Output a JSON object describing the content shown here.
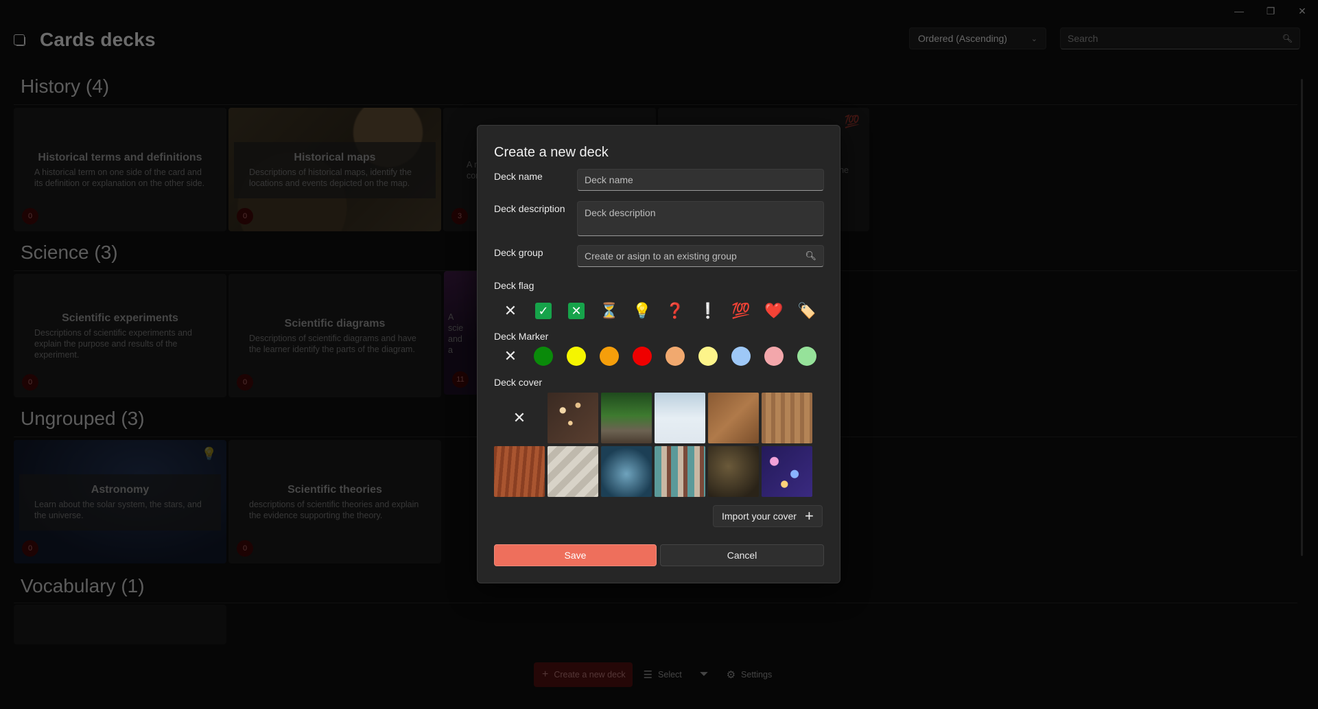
{
  "window": {
    "minimize": "—",
    "restore": "❐",
    "close": "✕"
  },
  "app": {
    "title": "Cards decks",
    "icon": "cards-icon"
  },
  "toolbar": {
    "sort": {
      "selected": "Ordered (Ascending)"
    },
    "search": {
      "placeholder": "Search"
    }
  },
  "groups": [
    {
      "title": "History (4)",
      "decks": [
        {
          "title": "Historical terms and definitions",
          "description": "A historical term on one side of the card and its definition or explanation on the other side.",
          "count": "0",
          "ribbon": "#0c8a0c"
        },
        {
          "title": "Historical maps",
          "description": "Descriptions of historical maps, identify the locations and events depicted on the map.",
          "count": "0"
        },
        {
          "title": "",
          "description": "A na cont",
          "count": "3"
        },
        {
          "title": "",
          "description": "f the",
          "count": "",
          "flag": "💯"
        }
      ]
    },
    {
      "title": "Science (3)",
      "decks": [
        {
          "title": "Scientific experiments",
          "description": "Descriptions of scientific experiments and explain the purpose and results of the experiment.",
          "count": "0"
        },
        {
          "title": "Scientific diagrams",
          "description": "Descriptions of scientific diagrams and have the learner identify the parts of the diagram.",
          "count": "0",
          "ribbon": "#a3a30a"
        },
        {
          "title": "",
          "description": "A scie and a",
          "count": "11"
        }
      ]
    },
    {
      "title": "Ungrouped (3)",
      "decks": [
        {
          "title": "Astronomy",
          "description": "Learn about the solar system, the stars, and the universe.",
          "count": "0",
          "ribbon": "#c21010",
          "flag": "💡"
        },
        {
          "title": "Scientific theories",
          "description": "descriptions of scientific theories and explain the evidence supporting the theory.",
          "count": "0"
        }
      ]
    },
    {
      "title": "Vocabulary (1)",
      "decks": []
    }
  ],
  "commandbar": {
    "create": "Create a new deck",
    "select": "Select",
    "settings": "Settings"
  },
  "dialog": {
    "title": "Create a new deck",
    "name": {
      "label": "Deck name",
      "placeholder": "Deck name"
    },
    "description": {
      "label": "Deck description",
      "placeholder": "Deck description"
    },
    "group": {
      "label": "Deck group",
      "placeholder": "Create or asign to an existing group"
    },
    "flag": {
      "label": "Deck flag",
      "options": [
        {
          "name": "none",
          "glyph": "✕"
        },
        {
          "name": "check",
          "glyph": "✓",
          "bg": "#16a34a"
        },
        {
          "name": "cross",
          "glyph": "✕",
          "bg": "#16a34a"
        },
        {
          "name": "hourglass",
          "glyph": "⏳"
        },
        {
          "name": "lightbulb",
          "glyph": "💡"
        },
        {
          "name": "question",
          "glyph": "❓"
        },
        {
          "name": "exclamation",
          "glyph": "❕"
        },
        {
          "name": "hundred",
          "glyph": "💯"
        },
        {
          "name": "heart",
          "glyph": "❤️"
        },
        {
          "name": "tag",
          "glyph": "🏷️"
        }
      ]
    },
    "marker": {
      "label": "Deck Marker",
      "colors": [
        "#0a8a0a",
        "#f5f500",
        "#f59e0b",
        "#ef0000",
        "#f1a96f",
        "#fdf48a",
        "#9ec8f7",
        "#f3a7ab",
        "#96e29a"
      ]
    },
    "cover": {
      "label": "Deck cover",
      "swatches": [
        "radial-gradient(circle at 30% 35%, #f3d7a8 0 6%, transparent 7%), radial-gradient(circle at 60% 25%, #e6c08a 0 5%, transparent 6%), radial-gradient(circle at 45% 60%, #f0cc95 0 5%, transparent 6%), linear-gradient(135deg, #3a2a22, #5a3f30)",
        "linear-gradient(180deg, #1f4a1d 0%, #3d7a2f 45%, #6c6252 75%, #4a3c30 100%)",
        "linear-gradient(180deg, #bcd0de 0%, #e6eef4 50%, #dfe7ee 100%)",
        "linear-gradient(135deg, #8a5a33, #b07a4a 50%, #7a4e2b)",
        "repeating-linear-gradient(90deg, #9a6c45 0 6px, #b48456 6px 14px)",
        "repeating-linear-gradient(95deg, #8a3f22 0 5px, #a95530 5px 11px)",
        "repeating-linear-gradient(135deg, #d8d3c8 0 10px, #bfb9ad 10px 20px)",
        "radial-gradient(circle at 50% 55%, #6fa3bd, #1c3f55 70%)",
        "repeating-linear-gradient(90deg, #5b9a9a 0 10px, #c9b7a3 10px 18px, #7a4a3a 18px 24px)",
        "radial-gradient(circle at 40% 40%, #6b5a3a, #2a2318 80%)",
        "radial-gradient(circle at 25% 30%, #f2a2d8 0 8%, transparent 9%), radial-gradient(circle at 65% 55%, #8ab4ff 0 9%, transparent 10%), radial-gradient(circle at 45% 75%, #ffd27a 0 7%, transparent 8%), linear-gradient(135deg, #241a5a, #3a2a80)"
      ]
    },
    "import_label": "Import your cover",
    "save_label": "Save",
    "cancel_label": "Cancel"
  }
}
